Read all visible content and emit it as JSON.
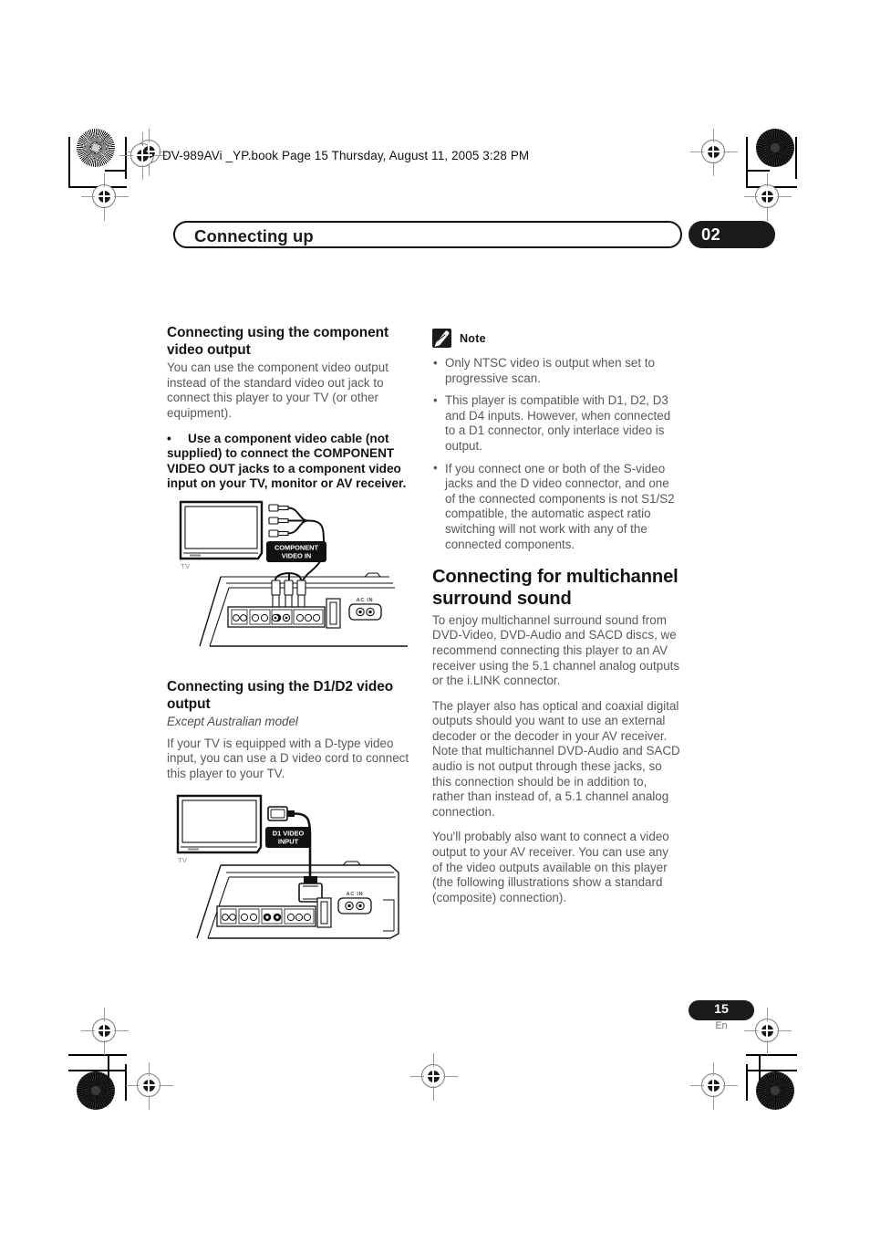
{
  "print_slug": "DV-989AVi _YP.book  Page 15  Thursday, August 11, 2005  3:28 PM",
  "header": {
    "chapter_title": "Connecting up",
    "chapter_number": "02"
  },
  "footer": {
    "page_number": "15",
    "language_code": "En"
  },
  "left_column": {
    "section1": {
      "heading": "Connecting using the component video output",
      "paragraph": "You can use the component video output instead of the standard video out jack to connect this player to your TV (or other equipment).",
      "bullet": "Use a component video cable (not supplied) to connect the COMPONENT VIDEO OUT jacks to a component video input on your TV, monitor or AV receiver.",
      "bullet_marker": "•"
    },
    "section2": {
      "heading": "Connecting using the D1/D2 video output",
      "subheading_italic": "Except Australian model",
      "paragraph": "If your TV is equipped with a D-type video input, you can use a D video cord to connect this player to your TV."
    }
  },
  "right_column": {
    "note_block": {
      "label": "Note",
      "icon": "pencil-note-icon",
      "items": [
        "Only NTSC video is output when set to progressive scan.",
        "This player is compatible with D1, D2, D3 and D4 inputs. However, when connected to a D1 connector, only interlace video is output.",
        "If you connect one or both of the S-video jacks and the D video connector, and one of the connected components is not S1/S2 compatible, the automatic aspect ratio switching will not work with any of the connected components."
      ]
    },
    "section": {
      "heading": "Connecting for multichannel surround sound",
      "paragraphs": [
        "To enjoy multichannel surround sound from DVD-Video, DVD-Audio and SACD discs, we recommend connecting this player to an AV receiver using the 5.1 channel analog outputs or the i.LINK connector.",
        "The player also has optical and coaxial digital outputs should you want to use an external decoder or the decoder in your AV receiver. Note that multichannel DVD-Audio and SACD audio is not output through these jacks, so this connection should be in addition to, rather than instead of, a 5.1 channel analog connection.",
        "You'll probably also want to connect a video output to your AV receiver. You can use any of the video outputs available on this player (the following illustrations show a standard (composite) connection)."
      ]
    }
  },
  "figure_component_video": {
    "tv_caption": "TV",
    "input_label_line1": "COMPONENT",
    "input_label_line2": "VIDEO IN",
    "ac_in_label": "AC IN"
  },
  "figure_d1_video": {
    "tv_caption": "TV",
    "input_label_line1": "D1 VIDEO",
    "input_label_line2": "INPUT",
    "ac_in_label": "AC IN"
  },
  "colors": {
    "ink_black": "#1a1a1a",
    "body_gray": "#585858",
    "reg_gray": "#9a9a9a"
  }
}
